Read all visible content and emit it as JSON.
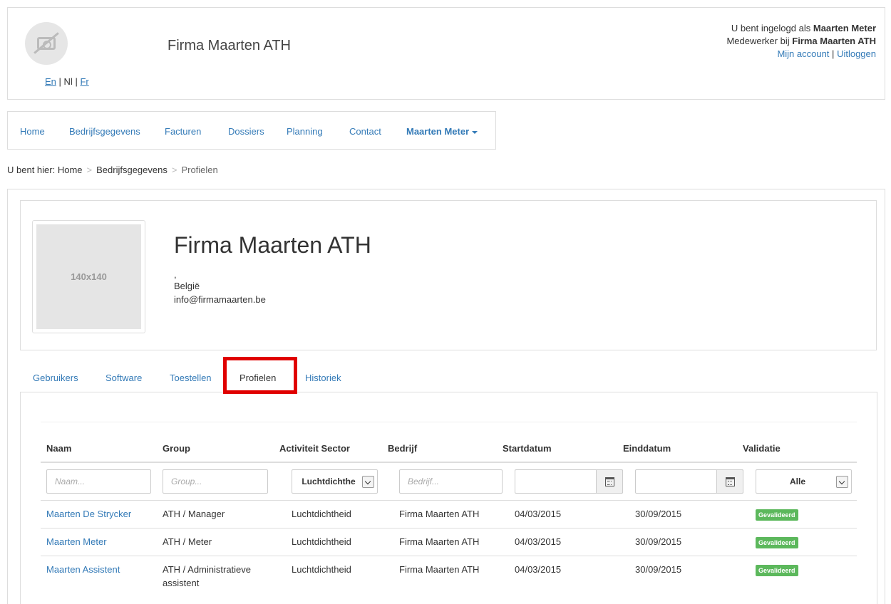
{
  "header": {
    "company": "Firma Maarten ATH",
    "languages": {
      "en": "En",
      "nl": "Nl",
      "fr": "Fr",
      "sep": "|"
    },
    "user_prefix": "U bent ingelogd als",
    "user_name": "Maarten Meter",
    "employee_prefix": "Medewerker bij",
    "employee_company": "Firma Maarten ATH",
    "account_link": "Mijn account",
    "logout_link": "Uitloggen",
    "link_sep": "|"
  },
  "nav": {
    "items": [
      "Home",
      "Bedrijfsgegevens",
      "Facturen",
      "Dossiers",
      "Planning",
      "Contact"
    ],
    "user_menu": "Maarten Meter"
  },
  "breadcrumb": {
    "label": "U bent hier:",
    "items": [
      "Home",
      "Bedrijfsgegevens",
      "Profielen"
    ],
    "separator": ">"
  },
  "profile": {
    "image_placeholder": "140x140",
    "name": "Firma Maarten ATH",
    "address_line": ",",
    "country": "België",
    "email": "info@firmamaarten.be"
  },
  "tabs": [
    "Gebruikers",
    "Software",
    "Toestellen",
    "Profielen",
    "Historiek"
  ],
  "active_tab": "Profielen",
  "table": {
    "columns": [
      "Naam",
      "Group",
      "Activiteit Sector",
      "Bedrijf",
      "Startdatum",
      "Einddatum",
      "Validatie"
    ],
    "filters": {
      "naam_placeholder": "Naam...",
      "group_placeholder": "Group...",
      "sector_selected": "Luchtdichthe",
      "bedrijf_placeholder": "Bedrijf...",
      "validatie_selected": "Alle"
    },
    "rows": [
      {
        "naam": "Maarten De Strycker",
        "group": "ATH / Manager",
        "sector": "Luchtdichtheid",
        "bedrijf": "Firma Maarten ATH",
        "start": "04/03/2015",
        "eind": "30/09/2015",
        "validatie": "Gevalideerd"
      },
      {
        "naam": "Maarten Meter",
        "group": "ATH / Meter",
        "sector": "Luchtdichtheid",
        "bedrijf": "Firma Maarten ATH",
        "start": "04/03/2015",
        "eind": "30/09/2015",
        "validatie": "Gevalideerd"
      },
      {
        "naam": "Maarten Assistent",
        "group": "ATH / Administratieve assistent",
        "sector": "Luchtdichtheid",
        "bedrijf": "Firma Maarten ATH",
        "start": "04/03/2015",
        "eind": "30/09/2015",
        "validatie": "Gevalideerd"
      }
    ]
  },
  "colors": {
    "link": "#337ab7",
    "badge": "#5cb85c",
    "highlight": "#e00000"
  },
  "icons": [
    "camera-off-icon",
    "calendar-icon",
    "chevron-down-icon",
    "caret-down-icon"
  ]
}
